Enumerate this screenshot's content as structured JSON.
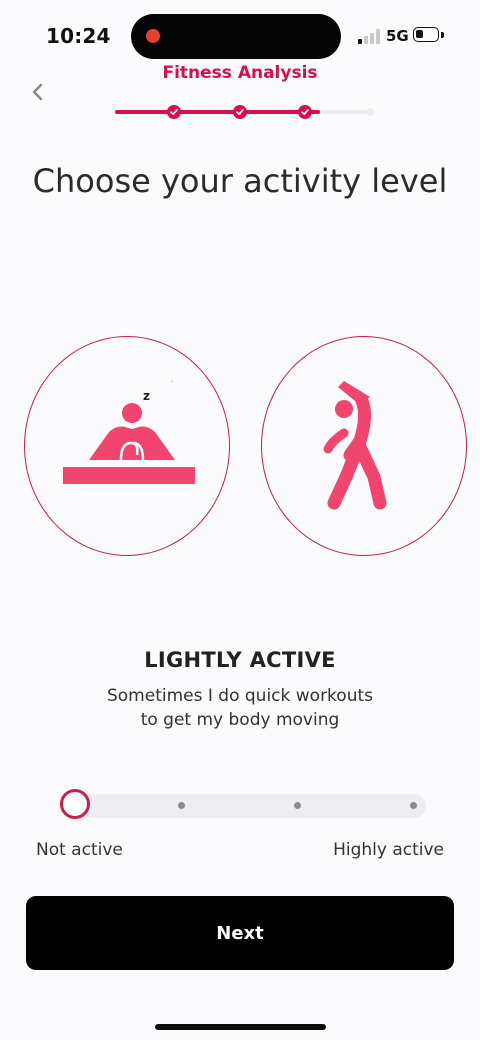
{
  "status_bar": {
    "time": "10:24",
    "network": "5G"
  },
  "header": {
    "title": "Fitness Analysis",
    "progress": {
      "completed_steps": 3,
      "total_steps": 4
    }
  },
  "main": {
    "heading": "Choose your activity level",
    "options": [
      {
        "icon": "sleeping-person-icon",
        "selected": false
      },
      {
        "icon": "stretching-person-icon",
        "selected": false
      }
    ],
    "level_title": "LIGHTLY ACTIVE",
    "description_line1": "Sometimes I do quick workouts",
    "description_line2": "to get my body moving"
  },
  "slider": {
    "min_label": "Not active",
    "max_label": "Highly active",
    "positions": 4,
    "selected_index": 0
  },
  "footer": {
    "next_label": "Next"
  },
  "colors": {
    "accent": "#d4114f",
    "icon_pink": "#f2456e",
    "button_bg": "#000000"
  }
}
